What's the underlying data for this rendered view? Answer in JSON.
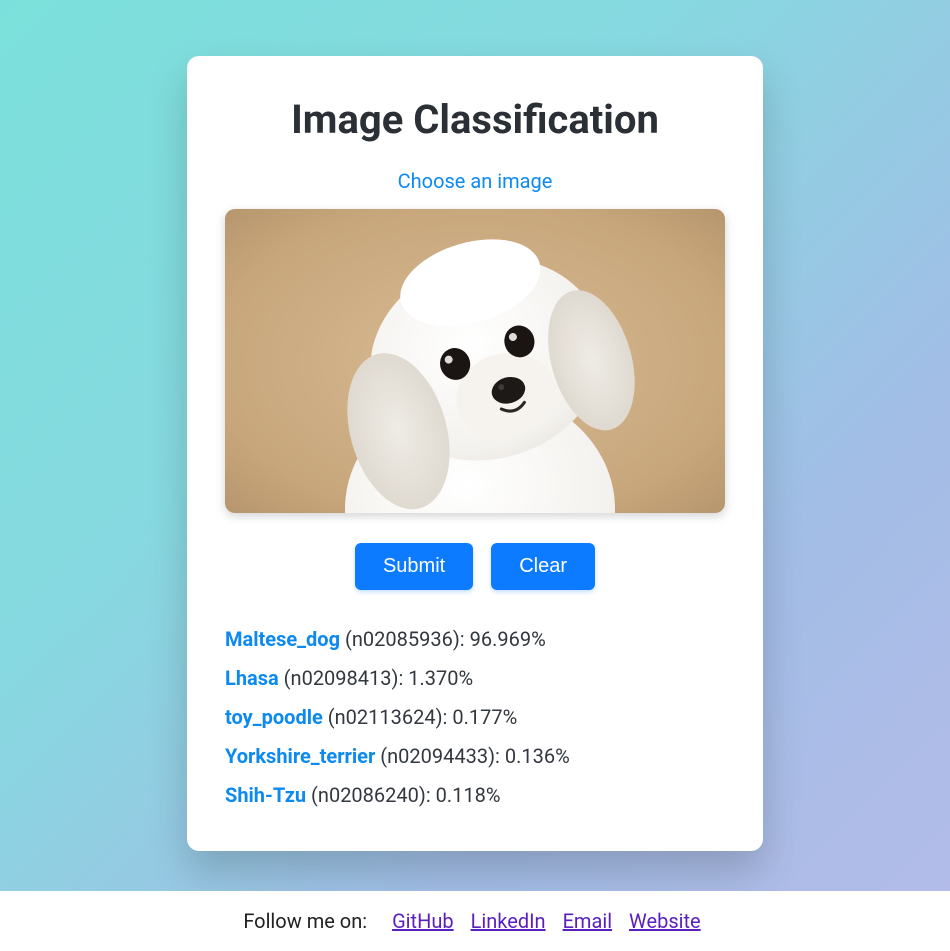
{
  "title": "Image Classification",
  "choose_label": "Choose an image",
  "buttons": {
    "submit": "Submit",
    "clear": "Clear"
  },
  "results": [
    {
      "label": "Maltese_dog",
      "code": "n02085936",
      "pct": "96.969%"
    },
    {
      "label": "Lhasa",
      "code": "n02098413",
      "pct": "1.370%"
    },
    {
      "label": "toy_poodle",
      "code": "n02113624",
      "pct": "0.177%"
    },
    {
      "label": "Yorkshire_terrier",
      "code": "n02094433",
      "pct": "0.136%"
    },
    {
      "label": "Shih-Tzu",
      "code": "n02086240",
      "pct": "0.118%"
    }
  ],
  "footer": {
    "follow": "Follow me on:",
    "links": [
      "GitHub",
      "LinkedIn",
      "Email",
      "Website"
    ]
  }
}
